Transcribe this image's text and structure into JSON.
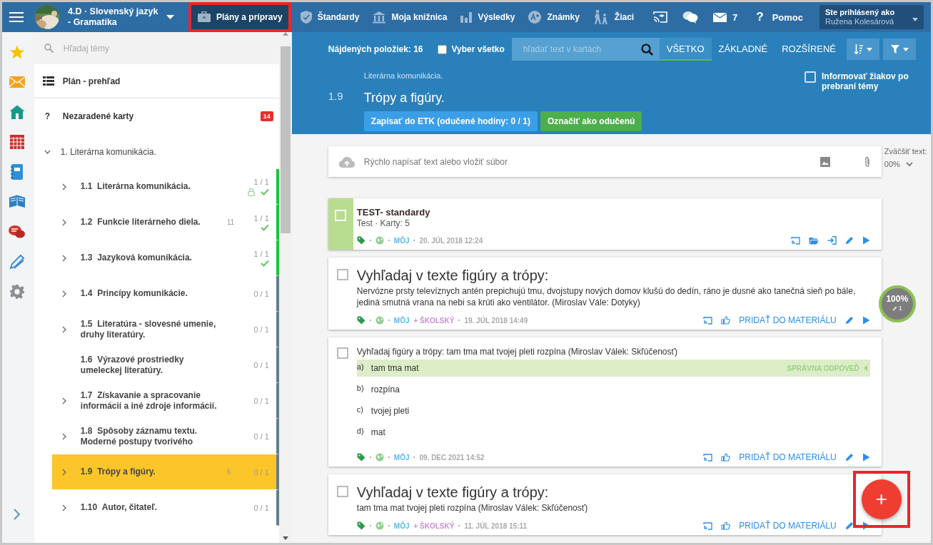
{
  "topbar": {
    "class_name": "4.D · Slovenský jazyk - Gramatika",
    "nav": [
      {
        "label": "Plány a prípravy",
        "kind": "briefcase",
        "selected": true,
        "highlighted": true
      },
      {
        "label": "Štandardy",
        "kind": "shield",
        "selected": false,
        "highlighted": false
      },
      {
        "label": "Moja knižnica",
        "kind": "library",
        "selected": false,
        "highlighted": false
      },
      {
        "label": "Výsledky",
        "kind": "chart",
        "selected": false,
        "highlighted": false
      },
      {
        "label": "Známky",
        "kind": "grade",
        "selected": false,
        "highlighted": false
      },
      {
        "label": "Žiaci",
        "kind": "pupils",
        "selected": false,
        "highlighted": false
      }
    ],
    "messages": "7",
    "help": "Pomoc",
    "help_mark": "?",
    "user": {
      "caption": "Ste prihlásený ako",
      "name": "Ružena Kolesárová"
    }
  },
  "sidebar": {
    "search_placeholder": "Hľadaj témy",
    "overview": "Plán - prehľad",
    "unsorted": {
      "mark": "?",
      "label": "Nezaradené karty",
      "badge": "14"
    },
    "chapter": {
      "label": "1. Literárna komunikácia.",
      "expanded": true,
      "children": [
        {
          "number": "1.1",
          "title": "Literárna komunikácia.",
          "progress": "1 / 1",
          "done": true,
          "locked": true,
          "expandable": true,
          "selected": false
        },
        {
          "number": "1.2",
          "title": "Funkcie literárneho diela.",
          "count": "11",
          "progress": "1 / 1",
          "done": true,
          "locked": false,
          "expandable": true,
          "selected": false
        },
        {
          "number": "1.3",
          "title": "Jazyková komunikácia.",
          "progress": "1 / 1",
          "done": true,
          "locked": false,
          "expandable": true,
          "selected": false
        },
        {
          "number": "1.4",
          "title": "Princípy komunikácie.",
          "progress": "0 / 1",
          "done": false,
          "locked": false,
          "expandable": true,
          "selected": false
        },
        {
          "number": "1.5",
          "title": "Literatúra - slovesné umenie, druhy literatúry.",
          "progress": "0 / 1",
          "done": false,
          "locked": false,
          "expandable": true,
          "selected": false
        },
        {
          "number": "1.6",
          "title": "Výrazové prostriedky umeleckej literatúry.",
          "progress": "0 / 1",
          "done": false,
          "locked": false,
          "expandable": false,
          "selected": false
        },
        {
          "number": "1.7",
          "title": "Získavanie a spracovanie informácií a iné zdroje informácií.",
          "progress": "0 / 1",
          "done": false,
          "locked": false,
          "expandable": true,
          "selected": false
        },
        {
          "number": "1.8",
          "title": "Spôsoby záznamu textu. Moderné postupy tvorivého",
          "progress": "0 / 1",
          "done": false,
          "locked": false,
          "expandable": true,
          "selected": false
        },
        {
          "number": "1.9",
          "title": "Trópy a figúry.",
          "count": "6",
          "progress": "0 / 1",
          "done": false,
          "locked": false,
          "expandable": true,
          "selected": true
        },
        {
          "number": "1.10",
          "title": "Autor, čitateľ.",
          "progress": "0 / 1",
          "done": false,
          "locked": false,
          "expandable": true,
          "selected": false
        }
      ]
    }
  },
  "toolbar": {
    "found": "Nájdených položiek: 16",
    "select_all": {
      "label": "Vyber všetko",
      "checked": false
    },
    "search_placeholder": "hľadať text v kartách",
    "filters": [
      {
        "label": "VŠETKO",
        "selected": true
      },
      {
        "label": "ZÁKLADNÉ",
        "selected": false
      },
      {
        "label": "ROZŠÍRENÉ",
        "selected": false
      }
    ]
  },
  "topic": {
    "breadcrumb": "Literárna komunikácia.",
    "number": "1.9",
    "title": "Trópy a figúry.",
    "buttons": [
      {
        "label": "Zapísať do ETK (odučené hodiny: 0 / 1)",
        "kind": "primary"
      },
      {
        "label": "Označiť ako odučenú",
        "kind": "success"
      }
    ],
    "notify": {
      "label": "Informovať žiakov po prebraní témy",
      "checked": false
    }
  },
  "composer": {
    "placeholder": "Rýchlo napísať text alebo vložiť súbor"
  },
  "zoom": {
    "label": "Zväčšiť text:",
    "value": "00%"
  },
  "cards": [
    {
      "kind": "test",
      "checked": false,
      "title": "TEST- standardy",
      "subtitle": "Test · Karty: 5",
      "owners": [
        "MÔJ"
      ],
      "date": "20. JÚL 2018 12:24"
    },
    {
      "kind": "question",
      "checked": false,
      "title": "Vyhľadaj v texte figúry a trópy:",
      "body": "Nervózne prsty televíznych antén prepichujú tmu, dvojstupy nových domov klušú do dedín, ráno je dusné ako tanečná sieň po bále, jediná smutná vrana na nebi sa krúti ako ventilátor. (Miroslav Vále: Dotyky)",
      "owners": [
        "MÔJ",
        "+ ŠKOLSKÝ"
      ],
      "date": "19. JÚL 2018 14:49",
      "add_label": "PRIDAŤ DO MATERIÁLU"
    },
    {
      "kind": "choice",
      "checked": false,
      "title": "Vyhľadaj figúry a trópy: tam tma mat tvojej pleti rozpína (Miroslav Válek: Skľúčenosť)",
      "correct_label": "SPRÁVNA ODPOVEĎ",
      "options": [
        {
          "letter": "a)",
          "text": "tam tma mat",
          "correct": true
        },
        {
          "letter": "b)",
          "text": "rozpína",
          "correct": false
        },
        {
          "letter": "c)",
          "text": "tvojej pleti",
          "correct": false
        },
        {
          "letter": "d)",
          "text": "mat",
          "correct": false
        }
      ],
      "owners": [
        "MÔJ"
      ],
      "date": "09. DEC 2021 14:52",
      "add_label": "PRIDAŤ DO MATERIÁLU"
    },
    {
      "kind": "question",
      "checked": false,
      "title": "Vyhľadaj v texte figúry a trópy:",
      "body": "tam tma mat tvojej pleti rozpína (Miroslav Válek: Skľúčenosť)",
      "owners": [
        "MÔJ",
        "+ ŠKOLSKÝ"
      ],
      "date": "11. JÚL 2018 15:11",
      "add_label": "PRIDAŤ DO MATERIÁLU"
    }
  ],
  "score": {
    "percent": "100%",
    "attempts": "1"
  },
  "fab": {
    "label": "+",
    "highlighted": true
  }
}
